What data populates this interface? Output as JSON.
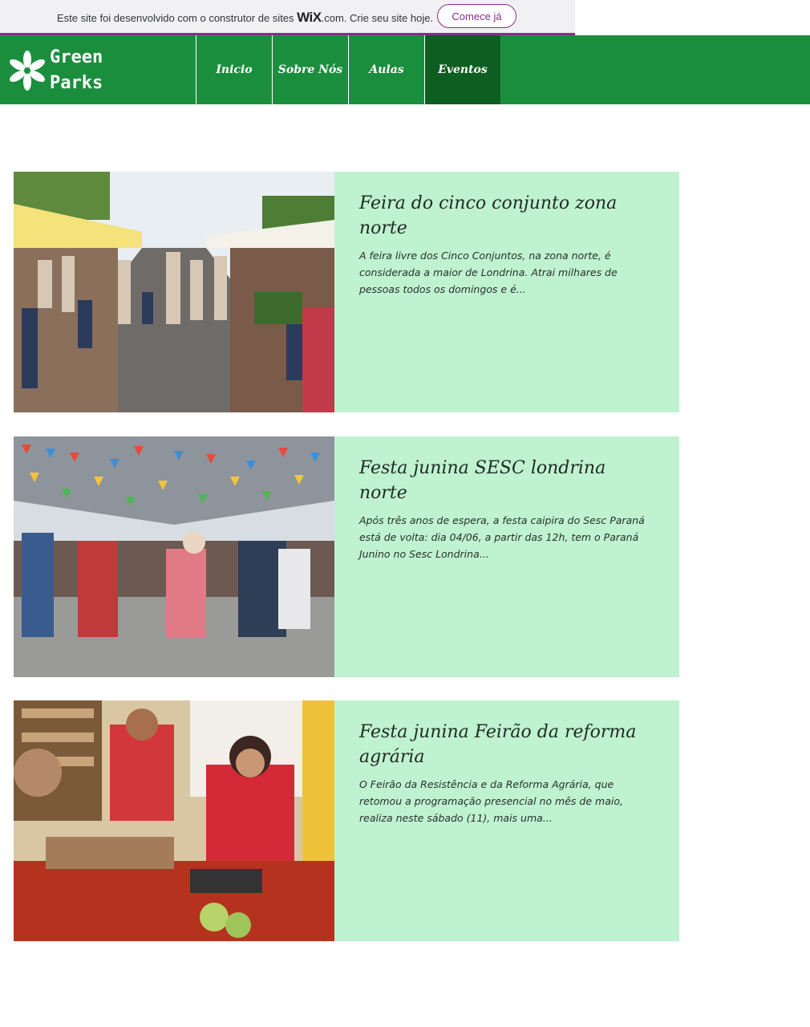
{
  "wix_banner": {
    "text_before": "Este site foi desenvolvido com o construtor de sites ",
    "logo": "WiX",
    "text_after": ".com. Crie seu site hoje.",
    "button_label": "Comece já"
  },
  "header": {
    "logo_line1": "Green",
    "logo_line2": "Parks",
    "nav": [
      {
        "label": "Inicio"
      },
      {
        "label": "Sobre Nós"
      },
      {
        "label": "Aulas"
      },
      {
        "label": "Eventos",
        "active": true
      }
    ]
  },
  "events": [
    {
      "title": "Feira do cinco conjunto zona norte",
      "excerpt": "A feira livre dos Cinco Conjuntos, na zona norte, é considerada a maior de Londrina. Atrai milhares de pessoas todos os domingos e é..."
    },
    {
      "title": "Festa junina SESC londrina norte",
      "excerpt": "Após três anos de espera, a festa caipira do Sesc Paraná está de volta: dia 04/06, a partir das 12h, tem o Paraná Junino no Sesc Londrina..."
    },
    {
      "title": "Festa junina Feirão da reforma agrária",
      "excerpt": "O Feirão da Resistência e da Reforma Agrária, que retomou a programação presencial no mês de maio, realiza neste sábado (11), mais uma..."
    }
  ],
  "colors": {
    "header_green": "#1b8e3e",
    "nav_active": "#0e5e22",
    "card_bg": "#bff2d1",
    "wix_purple": "#8a2c8f"
  }
}
